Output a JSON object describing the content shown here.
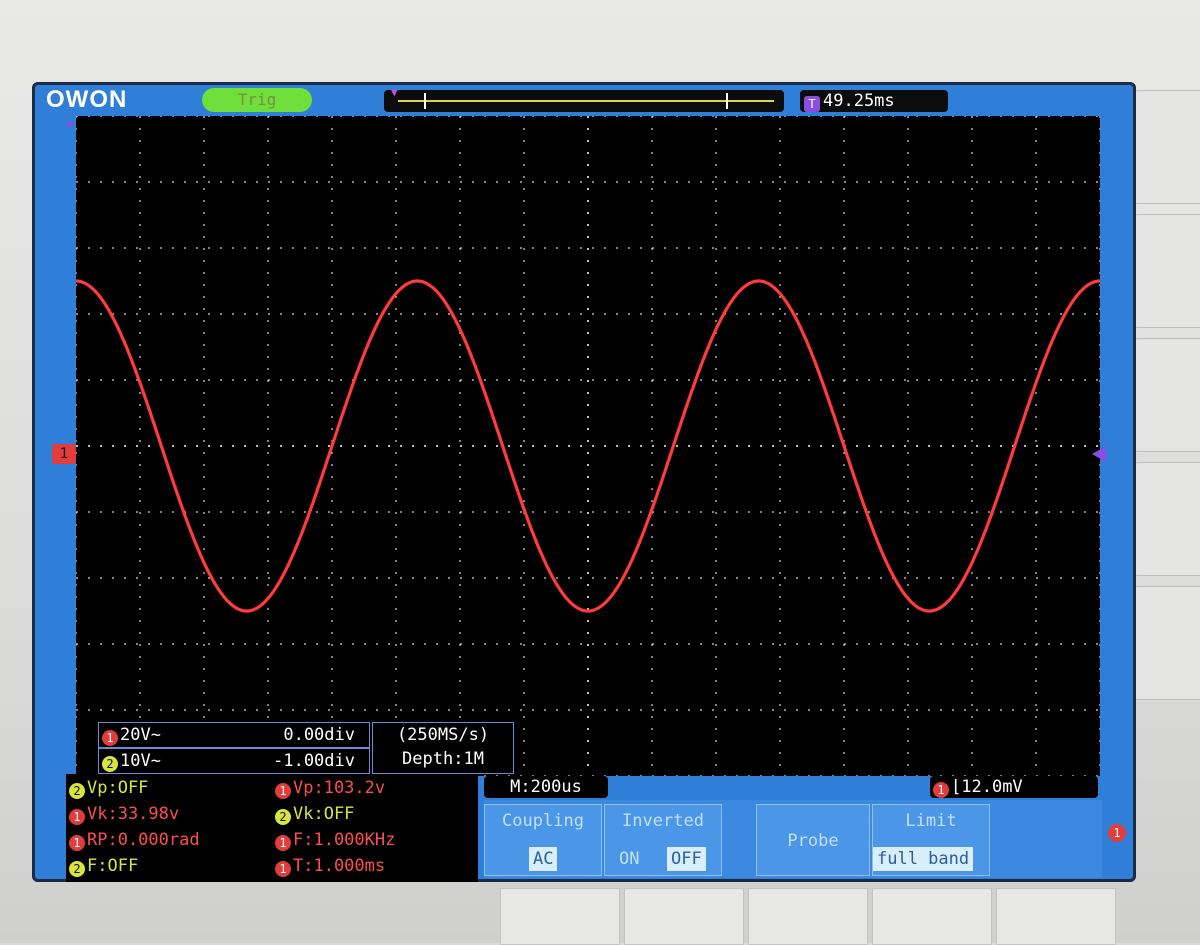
{
  "header": {
    "brand": "OWON",
    "trigger_status": "Trig",
    "trigger_time": "49.25ms",
    "trigger_time_icon": "T"
  },
  "channel1": {
    "pointer_label": "1",
    "scale": "20V~",
    "position": "0.00div",
    "color": "#ff3b3b"
  },
  "channel2": {
    "scale": "10V~",
    "position": "-1.00div"
  },
  "acquisition": {
    "sample_rate": "(250MS/s)",
    "depth": "Depth:1M"
  },
  "timebase": "M:200us",
  "trigger_level": "12.0mV",
  "measurements": {
    "ch2_vp": "Vp:OFF",
    "ch1_vk": "Vk:33.98v",
    "ch1_rp": "RP:0.000rad",
    "ch2_f": "F:OFF",
    "ch1_vp": "Vp:103.2v",
    "ch2_vk": "Vk:OFF",
    "ch1_f": "F:1.000KHz",
    "ch1_t": "T:1.000ms"
  },
  "menu": {
    "coupling_title": "Coupling",
    "coupling_value": "AC",
    "inverted_title": "Inverted",
    "inverted_on": "ON",
    "inverted_off": "OFF",
    "probe_title": "Probe",
    "limit_title": "Limit",
    "limit_value": "full band"
  },
  "waveform": {
    "type": "sine",
    "cycles_visible": 3.0,
    "amplitude_div": 2.5,
    "offset_div": 0.0
  },
  "colors": {
    "screen_blue": "#2f7ed8",
    "ch1": "#ff3b3b",
    "ch2": "#d7e63c",
    "trigger": "#8a4fe0"
  },
  "side_indicator": "1"
}
